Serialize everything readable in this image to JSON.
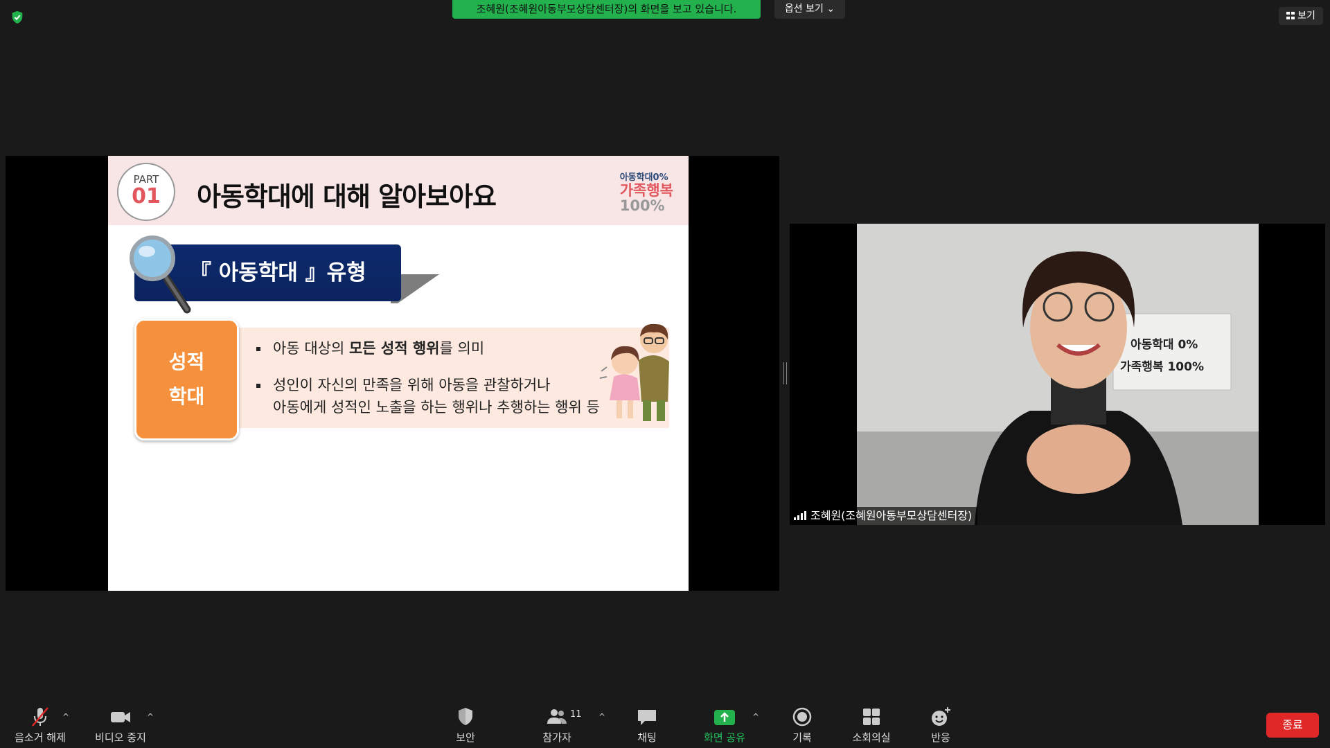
{
  "top": {
    "share_banner": "조혜원(조혜원아동부모상담센터장)의 화면을 보고 있습니다.",
    "options_label": "옵션 보기",
    "view_label": "보기"
  },
  "slide": {
    "part_label": "PART",
    "part_number": "01",
    "title": "아동학대에 대해 알아보아요",
    "brand_line1": "아동학대0%",
    "brand_line2": "가족행복",
    "brand_line3": "100%",
    "ribbon_label": "『 아동학대 』유형",
    "category_line1": "성적",
    "category_line2": "학대",
    "bullet1_pre": "아동 대상의 ",
    "bullet1_bold": "모든 성적 행위",
    "bullet1_post": "를 의미",
    "bullet2_line1": "성인이 자신의 만족을 위해 아동을 관찰하거나",
    "bullet2_line2": "아동에게 성적인 노출을 하는 행위나 추행하는 행위 등",
    "colors": {
      "header_bg": "#f8e6e7",
      "accent_red": "#e2565e",
      "ribbon_blue": "#0e2a6b",
      "category_orange": "#f5913c"
    }
  },
  "video": {
    "participant_name": "조혜원(조혜원아동부모상담센터장)",
    "sign_text_line1": "아동학대 0%",
    "sign_text_line2": "가족행복 100%"
  },
  "toolbar": {
    "mute_label": "음소거 해제",
    "video_label": "비디오 중지",
    "security_label": "보안",
    "participants_label": "참가자",
    "participants_count": "11",
    "chat_label": "채팅",
    "share_label": "화면 공유",
    "record_label": "기록",
    "breakout_label": "소회의실",
    "reactions_label": "반응",
    "end_label": "종료",
    "colors": {
      "share_green": "#22b14c",
      "end_red": "#e02828"
    }
  }
}
